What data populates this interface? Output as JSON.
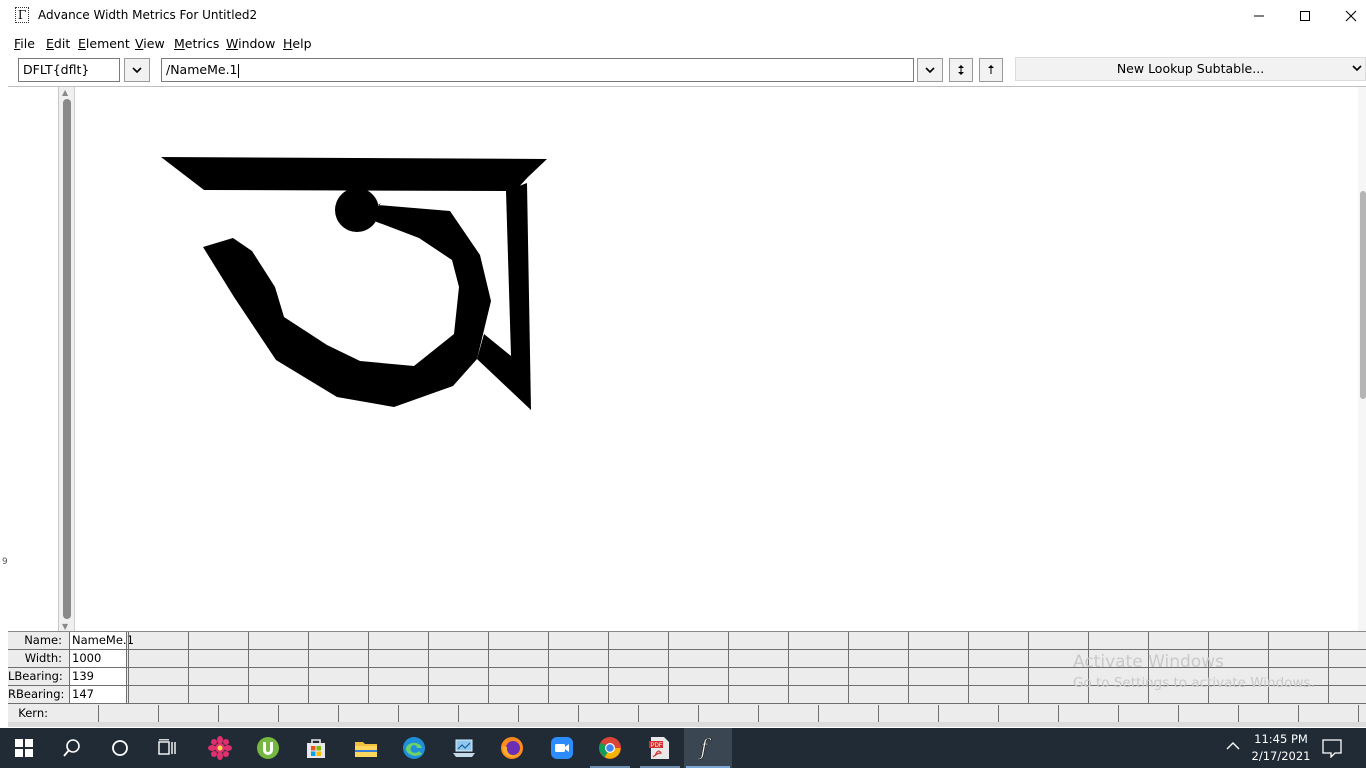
{
  "window": {
    "title": "Advance Width Metrics For Untitled2",
    "app_icon_glyph": "Γ"
  },
  "menu": [
    "File",
    "Edit",
    "Element",
    "View",
    "Metrics",
    "Window",
    "Help"
  ],
  "toolbar": {
    "script_field": "DFLT{dflt}",
    "glyph_text": "/NameMe.1",
    "lookup_subtable": "New Lookup Subtable..."
  },
  "canvas": {
    "left_marker": "9",
    "glyph_color": "#000000"
  },
  "metrics": {
    "name_label": "Name:",
    "name_value": "NameMe.1",
    "width_label": "Width:",
    "width_value": "1000",
    "lbearing_label": "LBearing:",
    "lbearing_value": "139",
    "rbearing_label": "RBearing:",
    "rbearing_value": "147",
    "kern_label": "Kern:"
  },
  "watermark": {
    "line1": "Activate Windows",
    "line2": "Go to Settings to activate Windows."
  },
  "taskbar": {
    "time": "11:45 PM",
    "date": "2/17/2021",
    "icons": [
      "windows-start-icon",
      "search-icon",
      "cortana-icon",
      "task-view-icon",
      "flower-app-icon",
      "utorrent-icon",
      "store-icon",
      "file-explorer-icon",
      "edge-icon",
      "network-laptop-icon",
      "firefox-icon",
      "zoom-icon",
      "chrome-icon",
      "pdf-reader-icon",
      "fontforge-icon"
    ]
  },
  "colors": {
    "taskbar_bg": "#202b36",
    "metrics_bg": "#ececec",
    "active_indicator": "#7aa7d6"
  }
}
